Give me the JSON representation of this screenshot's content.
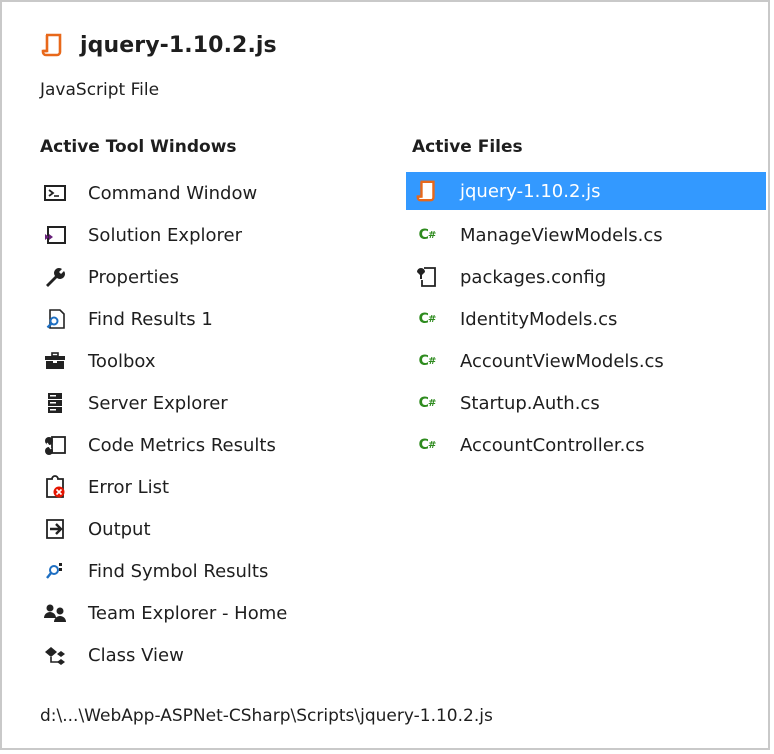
{
  "header": {
    "title": "jquery-1.10.2.js",
    "subtitle": "JavaScript File",
    "icon": "javascript-file-icon"
  },
  "tool_windows": {
    "heading": "Active Tool Windows",
    "items": [
      {
        "label": "Command Window",
        "icon": "command-window-icon"
      },
      {
        "label": "Solution Explorer",
        "icon": "solution-explorer-icon"
      },
      {
        "label": "Properties",
        "icon": "wrench-icon"
      },
      {
        "label": "Find Results 1",
        "icon": "find-results-icon"
      },
      {
        "label": "Toolbox",
        "icon": "toolbox-icon"
      },
      {
        "label": "Server Explorer",
        "icon": "server-icon"
      },
      {
        "label": "Code Metrics Results",
        "icon": "code-metrics-icon"
      },
      {
        "label": "Error List",
        "icon": "error-list-icon"
      },
      {
        "label": "Output",
        "icon": "output-icon"
      },
      {
        "label": "Find Symbol Results",
        "icon": "find-symbol-icon"
      },
      {
        "label": "Team Explorer - Home",
        "icon": "team-explorer-icon"
      },
      {
        "label": "Class View",
        "icon": "class-view-icon"
      }
    ]
  },
  "active_files": {
    "heading": "Active Files",
    "selected_index": 0,
    "items": [
      {
        "label": "jquery-1.10.2.js",
        "icon": "javascript-file-icon"
      },
      {
        "label": "ManageViewModels.cs",
        "icon": "csharp-file-icon"
      },
      {
        "label": "packages.config",
        "icon": "config-file-icon"
      },
      {
        "label": "IdentityModels.cs",
        "icon": "csharp-file-icon"
      },
      {
        "label": "AccountViewModels.cs",
        "icon": "csharp-file-icon"
      },
      {
        "label": "Startup.Auth.cs",
        "icon": "csharp-file-icon"
      },
      {
        "label": "AccountController.cs",
        "icon": "csharp-file-icon"
      }
    ]
  },
  "footer": {
    "path": "d:\\...\\WebApp-ASPNet-CSharp\\Scripts\\jquery-1.10.2.js"
  },
  "colors": {
    "selection": "#3399ff",
    "csharp": "#2e8b1e",
    "javascript": "#e8681a"
  }
}
